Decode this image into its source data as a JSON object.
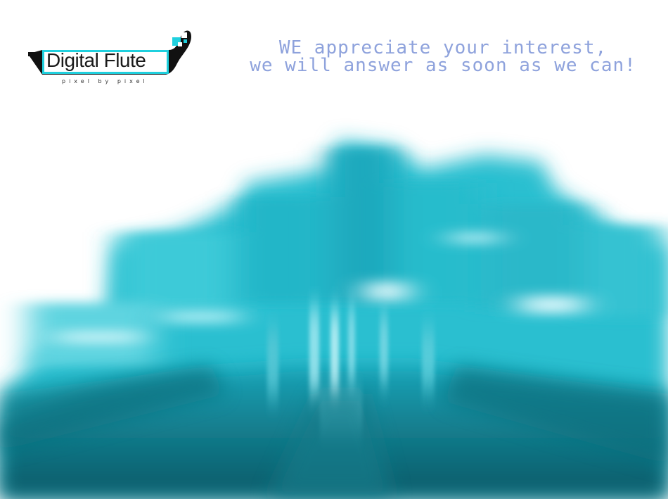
{
  "logo": {
    "name": "Digital Flute",
    "tagline": "pixel by pixel"
  },
  "message": {
    "line1": "WE appreciate your interest,",
    "line2": "we will answer as soon as we can!"
  },
  "colors": {
    "accent": "#1fd0de",
    "message_text": "#8ea2dc",
    "hero_deep": "#0e5f6c",
    "hero_mid": "#1aa4b8",
    "hero_light": "#6fe0ec"
  }
}
